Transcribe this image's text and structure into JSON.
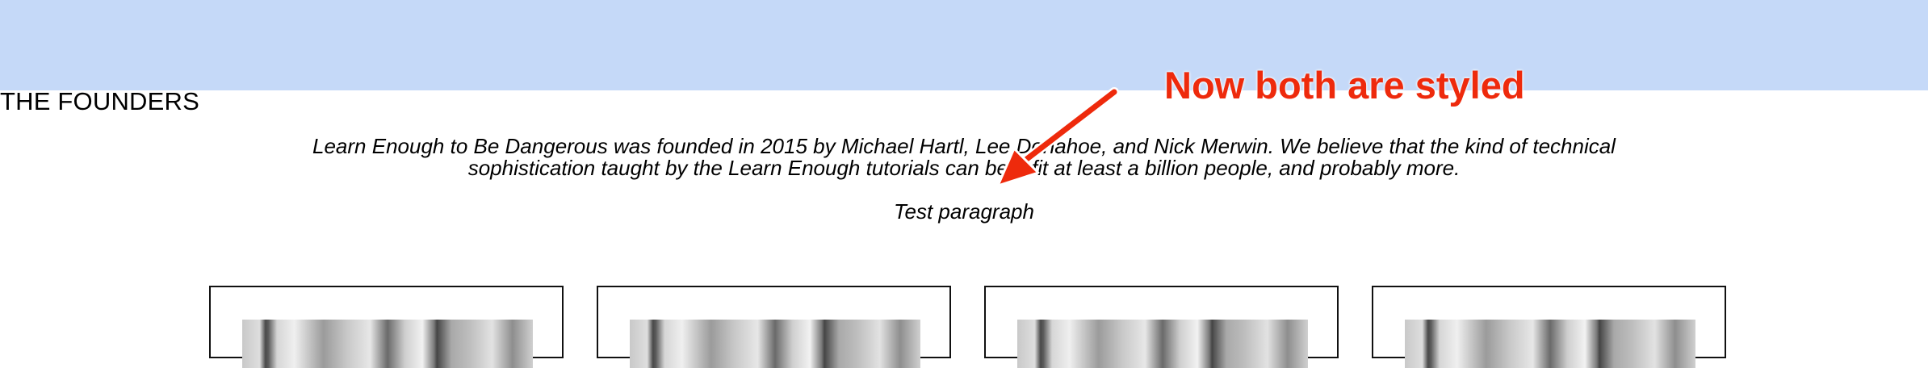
{
  "section": {
    "title": "THE FOUNDERS",
    "intro_line1": "Learn Enough to Be Dangerous was founded in 2015 by Michael Hartl, Lee Donahoe, and Nick Merwin. We believe that the kind of technical",
    "intro_line2": "sophistication taught by the Learn Enough tutorials can benefit at least a billion people, and probably more.",
    "test_paragraph": "Test paragraph"
  },
  "annotation": {
    "text": "Now both are styled",
    "color": "#ee2a0c"
  },
  "colors": {
    "banner": "#c5d9f8",
    "background": "#ffffff"
  },
  "cards": [
    {
      "name": "founder-card-1"
    },
    {
      "name": "founder-card-2"
    },
    {
      "name": "founder-card-3"
    },
    {
      "name": "founder-card-4"
    }
  ]
}
